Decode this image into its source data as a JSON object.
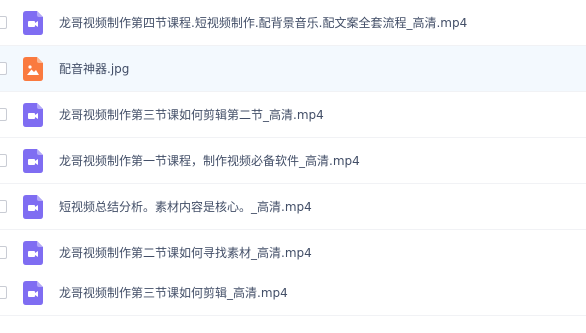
{
  "files": [
    {
      "name": "龙哥视频制作第四节课程.短视频制作.配背景音乐.配文案全套流程_高清.mp4",
      "type": "video",
      "icon": "video-file-icon"
    },
    {
      "name": "配音神器.jpg",
      "type": "image",
      "icon": "image-file-icon"
    },
    {
      "name": "龙哥视频制作第三节课如何剪辑第二节_高清.mp4",
      "type": "video",
      "icon": "video-file-icon"
    },
    {
      "name": "龙哥视频制作第一节课程，制作视频必备软件_高清.mp4",
      "type": "video",
      "icon": "video-file-icon"
    },
    {
      "name": "短视频总结分析。素材内容是核心。_高清.mp4",
      "type": "video",
      "icon": "video-file-icon"
    },
    {
      "name": "龙哥视频制作第二节课如何寻找素材_高清.mp4",
      "type": "video",
      "icon": "video-file-icon"
    },
    {
      "name": "龙哥视频制作第三节课如何剪辑_高清.mp4",
      "type": "video",
      "icon": "video-file-icon"
    }
  ],
  "colors": {
    "video_icon": "#7f6df2",
    "image_icon": "#fa7a3f",
    "selected_row": "#f3f9fe",
    "text": "#424e67"
  }
}
